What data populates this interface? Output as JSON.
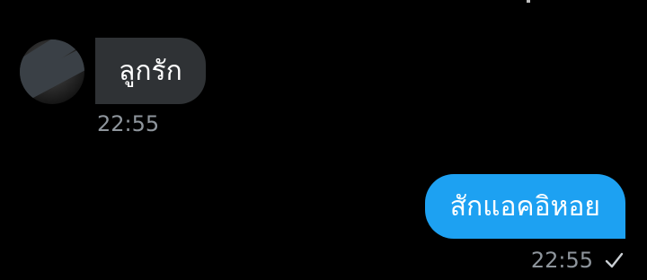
{
  "conversation": {
    "incoming": {
      "text": "ลูกรัก",
      "time": "22:55",
      "avatar_icon": "profile-photo"
    },
    "outgoing": {
      "text": "สักแอคอิหอย",
      "time": "22:55",
      "status_icon": "check-icon"
    }
  },
  "colors": {
    "background": "#000000",
    "incoming_bubble": "#2f3235",
    "outgoing_bubble": "#1da1f2",
    "timestamp": "#8e959c"
  }
}
